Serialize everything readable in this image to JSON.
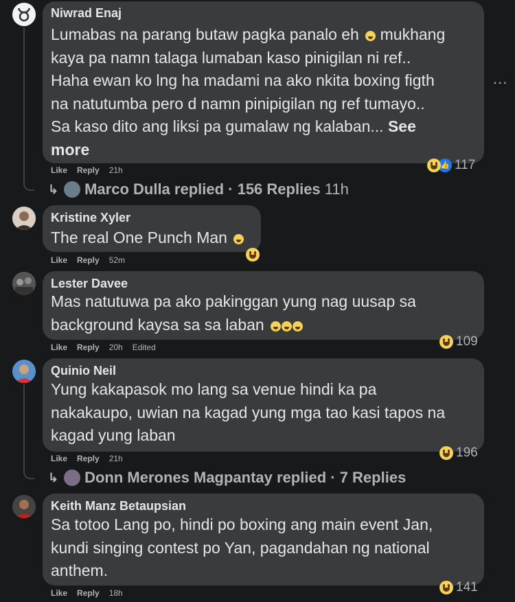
{
  "colors": {
    "background": "#18191a",
    "bubble": "#3a3b3c",
    "text": "#e4e6eb",
    "muted": "#b0b3b8",
    "like_blue": "#1877f2",
    "haha_yellow": "#f7d25a"
  },
  "comments": [
    {
      "author": "Niwrad Enaj",
      "avatar_icon": "taurus-icon",
      "lines": [
        "Lumabas na parang butaw pagka panalo eh",
        "kaya pa namn talaga lumaban kaso pinigilan ni ref..",
        "Haha ewan ko lng ha madami na ako nkita boxing figth",
        "na natutumba pero d namn pinipigilan ng ref tumayo..",
        "Sa kaso dito ang liksi pa gumalaw ng kalaban..."
      ],
      "line1_tail": "mukhang",
      "see_more": "See",
      "see_more_2": "more",
      "actions": {
        "like": "Like",
        "reply": "Reply",
        "time": "21h"
      },
      "reactions": {
        "icons": [
          "haha-icon",
          "like-icon"
        ],
        "count": "117"
      },
      "replies": {
        "text": "Marco Dulla replied · 156 Replies",
        "time": "11h"
      }
    },
    {
      "author": "Kristine Xyler",
      "lines": [
        "The real One Punch Man"
      ],
      "actions": {
        "like": "Like",
        "reply": "Reply",
        "time": "52m"
      },
      "reactions": {
        "icons": [
          "haha-icon"
        ],
        "count": ""
      }
    },
    {
      "author": "Lester Davee",
      "lines": [
        "Mas natutuwa pa ako pakinggan yung nag uusap sa",
        "background kaysa sa sa laban"
      ],
      "actions": {
        "like": "Like",
        "reply": "Reply",
        "time": "20h",
        "edited": "Edited"
      },
      "reactions": {
        "icons": [
          "haha-icon"
        ],
        "count": "109"
      }
    },
    {
      "author": "Quinio Neil",
      "lines": [
        "Yung kakapasok mo lang sa venue hindi ka pa",
        "nakakaupo, uwian na kagad yung mga tao kasi tapos na",
        "kagad yung laban"
      ],
      "actions": {
        "like": "Like",
        "reply": "Reply",
        "time": "21h"
      },
      "reactions": {
        "icons": [
          "haha-icon"
        ],
        "count": "196"
      },
      "replies": {
        "text": "Donn Merones Magpantay replied · 7 Replies",
        "time": ""
      }
    },
    {
      "author": "Keith Manz Betaupsian",
      "lines": [
        "Sa totoo Lang po, hindi po boxing ang main event Jan,",
        "kundi singing contest po Yan, pagandahan ng national",
        "anthem."
      ],
      "actions": {
        "like": "Like",
        "reply": "Reply",
        "time": "18h"
      },
      "reactions": {
        "icons": [
          "haha-icon"
        ],
        "count": "141"
      }
    }
  ],
  "more_options": "..."
}
